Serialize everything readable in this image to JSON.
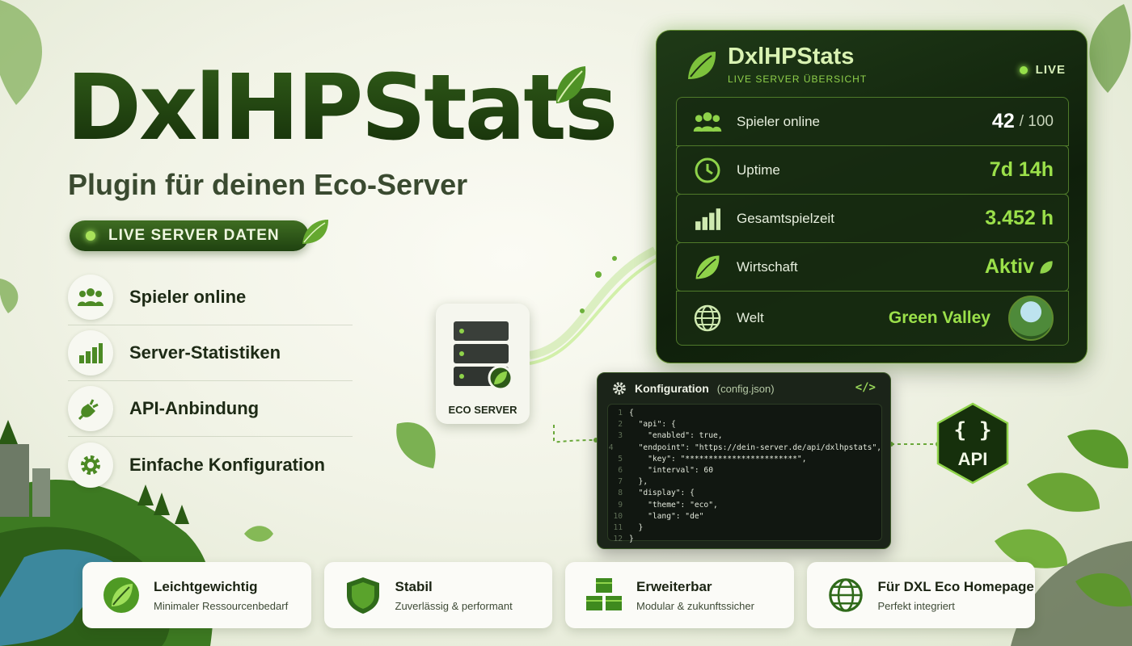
{
  "hero": {
    "title": "DxlHPStats",
    "subtitle": "Plugin für deinen Eco-Server",
    "badge": "LIVE SERVER DATEN"
  },
  "features": [
    {
      "label": "Spieler online",
      "icon": "users-icon"
    },
    {
      "label": "Server-Statistiken",
      "icon": "bar-chart-icon"
    },
    {
      "label": "API-Anbindung",
      "icon": "plug-icon"
    },
    {
      "label": "Einfache Konfiguration",
      "icon": "gear-icon"
    }
  ],
  "panel": {
    "title": "DxlHPStats",
    "subtitle": "LIVE SERVER ÜBERSICHT",
    "live": "LIVE",
    "rows": [
      {
        "label": "Spieler online",
        "value": "42",
        "suffix": "/ 100",
        "icon": "users-icon"
      },
      {
        "label": "Uptime",
        "value": "7d 14h",
        "suffix": "",
        "icon": "clock-icon"
      },
      {
        "label": "Gesamtspielzeit",
        "value": "3.452 h",
        "suffix": "",
        "icon": "bar-chart-icon"
      },
      {
        "label": "Wirtschaft",
        "value": "Aktiv",
        "suffix": "",
        "icon": "leaf-icon"
      },
      {
        "label": "Welt",
        "value": "Green Valley",
        "suffix": "",
        "icon": "globe-icon"
      }
    ]
  },
  "eco_server": {
    "label": "ECO SERVER"
  },
  "config": {
    "title": "Konfiguration",
    "file": "(config.json)",
    "tag": "</>",
    "lines": [
      {
        "n": "1",
        "t": "{"
      },
      {
        "n": "2",
        "t": "  \"api\": {"
      },
      {
        "n": "3",
        "t": "    \"enabled\": true,"
      },
      {
        "n": "4",
        "t": "    \"endpoint\": \"https://dein-server.de/api/dxlhpstats\","
      },
      {
        "n": "5",
        "t": "    \"key\": \"************************\","
      },
      {
        "n": "6",
        "t": "    \"interval\": 60"
      },
      {
        "n": "7",
        "t": "  },"
      },
      {
        "n": "8",
        "t": "  \"display\": {"
      },
      {
        "n": "9",
        "t": "    \"theme\": \"eco\","
      },
      {
        "n": "10",
        "t": "    \"lang\": \"de\""
      },
      {
        "n": "11",
        "t": "  }"
      },
      {
        "n": "12",
        "t": "}"
      }
    ]
  },
  "api_badge": {
    "braces": "{ }",
    "label": "API"
  },
  "cards": [
    {
      "title": "Leichtgewichtig",
      "desc": "Minimaler Ressourcenbedarf",
      "icon": "leaf-icon"
    },
    {
      "title": "Stabil",
      "desc": "Zuverlässig & performant",
      "icon": "shield-icon"
    },
    {
      "title": "Erweiterbar",
      "desc": "Modular & zukunftssicher",
      "icon": "cubes-icon"
    },
    {
      "title": "Für DXL Eco Homepage",
      "desc": "Perfekt integriert",
      "icon": "globe-icon"
    }
  ],
  "colors": {
    "accent": "#8fd34a",
    "dark": "#14260d",
    "brand": "#2f5a18"
  }
}
